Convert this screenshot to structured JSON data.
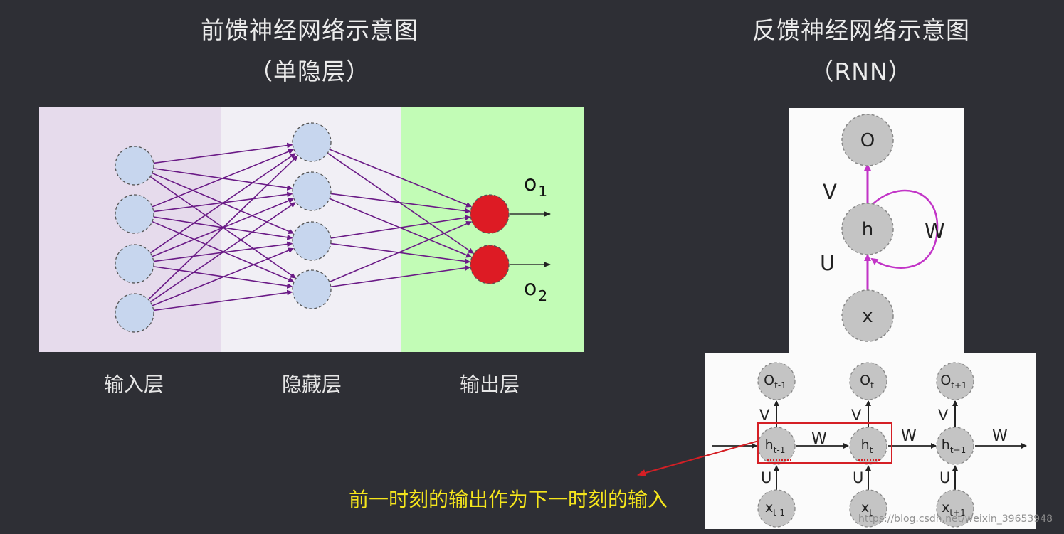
{
  "left_diagram": {
    "title": "前馈神经网络示意图",
    "subtitle": "（单隐层）",
    "layers": [
      {
        "label": "输入层",
        "color": "#e6dbec",
        "nodes": 4
      },
      {
        "label": "隐藏层",
        "color": "#f1eff5",
        "nodes": 4
      },
      {
        "label": "输出层",
        "color": "#c2fcb6",
        "nodes": 2
      }
    ],
    "outputs": [
      {
        "main": "o",
        "sub": "1"
      },
      {
        "main": "o",
        "sub": "2"
      }
    ],
    "colors": {
      "node_fill": "#c7d6ee",
      "output_fill": "#dd1b24",
      "connection": "#6a1a86"
    }
  },
  "right_diagram": {
    "title": "反馈神经网络示意图",
    "subtitle": "（RNN）",
    "folded": {
      "nodes": {
        "output": "O",
        "hidden": "h",
        "input": "x"
      },
      "edges": {
        "v": "V",
        "u": "U",
        "w": "W"
      },
      "color": "#c234c7"
    },
    "unfolded": {
      "steps": [
        {
          "o": "O",
          "o_sub": "t-1",
          "h": "h",
          "h_sub": "t-1",
          "x": "x",
          "x_sub": "t-1"
        },
        {
          "o": "O",
          "o_sub": "t",
          "h": "h",
          "h_sub": "t",
          "x": "x",
          "x_sub": "t"
        },
        {
          "o": "O",
          "o_sub": "t+1",
          "h": "h",
          "h_sub": "t+1",
          "x": "x",
          "x_sub": "t+1"
        }
      ],
      "v_label": "V",
      "u_label": "U",
      "w_label": "W",
      "highlight_color": "#d51f25"
    }
  },
  "caption": "前一时刻的输出作为下一时刻的输入",
  "watermark": "https://blog.csdn.net/weixin_39653948"
}
